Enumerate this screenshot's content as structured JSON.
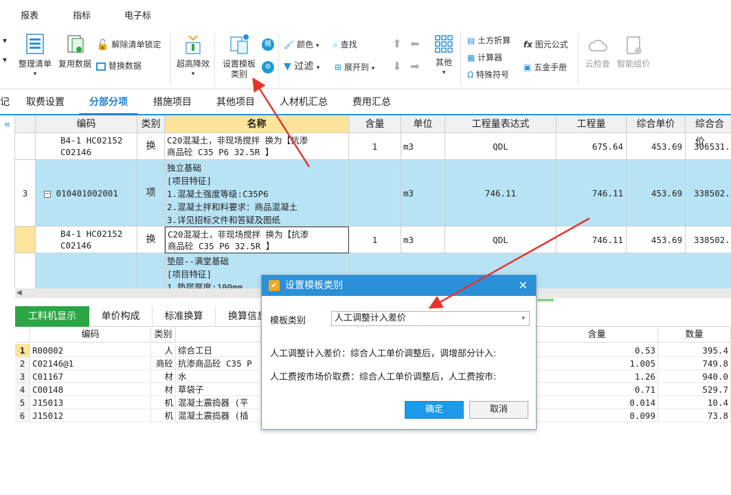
{
  "menu": {
    "items": [
      "报表",
      "指标",
      "电子标"
    ]
  },
  "ribbon": {
    "unlock": "解除清单锁定",
    "organize": "整理清单",
    "reuse": "复用数据",
    "replace": "替换数据",
    "downgrade": "超高降效",
    "set_template_line1": "设置模板",
    "set_template_line2": "类别",
    "color": "颜色",
    "find": "查找",
    "filter": "过滤",
    "expand": "展开到",
    "other": "其他",
    "earthwork": "土方折算",
    "calculator": "计算器",
    "special_symbol": "特殊符号",
    "formula": "图元公式",
    "hardware": "五金手册",
    "cloud_check": "云检查",
    "smart_price": "智能组价"
  },
  "tabs": [
    "记",
    "取费设置",
    "分部分项",
    "措施项目",
    "其他项目",
    "人材机汇总",
    "费用汇总"
  ],
  "grid": {
    "headers": [
      "编码",
      "类别",
      "名称",
      "含量",
      "单位",
      "工程量表达式",
      "工程量",
      "综合单价",
      "综合合价"
    ],
    "rows": [
      {
        "num": "",
        "code_l1": "B4-1 HC02152",
        "code_l2": "C02146",
        "type": "换",
        "name_l1": "C20混凝土，非现场搅拌  换为【抗渗",
        "name_l2": "商品砼 C35 P6 32.5R 】",
        "content": "1",
        "unit": "m3",
        "expr": "QDL",
        "qty": "675.64",
        "price": "453.69",
        "total": "306531."
      },
      {
        "num": "3",
        "code_l1": "010401002001",
        "type": "项",
        "name_lines": [
          "独立基础",
          "[项目特征]",
          "1.混凝土强度等级:C35P6",
          "2.混凝土拌和料要求：商品混凝土",
          "3.详见招标文件和答疑及图纸"
        ],
        "unit": "m3",
        "expr": "746.11",
        "qty": "746.11",
        "price": "453.69",
        "total": "338502."
      },
      {
        "num": "",
        "code_l1": "B4-1 HC02152",
        "code_l2": "C02146",
        "type": "换",
        "name_l1": "C20混凝土，非现场搅拌  换为【抗渗",
        "name_l2": "商品砼 C35 P6 32.5R 】",
        "content": "1",
        "unit": "m3",
        "expr": "QDL",
        "qty": "746.11",
        "price": "453.69",
        "total": "338502."
      },
      {
        "num": "",
        "name_lines": [
          "垫层--满堂基础",
          "[项目特征]",
          "1.垫层厚度:100mm"
        ]
      }
    ]
  },
  "subtabs": [
    "工料机显示",
    "单价构成",
    "标准换算",
    "换算信息"
  ],
  "subgrid": {
    "headers": [
      "编码",
      "类别",
      "含量",
      "数量"
    ],
    "rows": [
      {
        "n": "1",
        "code": "R00002",
        "type": "人",
        "name": "综合工日",
        "content": "0.53",
        "qty": "395.4"
      },
      {
        "n": "2",
        "code": "C02146@1",
        "type": "商砼",
        "name": "抗渗商品砼 C35 P",
        "content": "1.005",
        "qty": "749.8"
      },
      {
        "n": "3",
        "code": "C01167",
        "type": "材",
        "name": "水",
        "content": "1.26",
        "qty": "940.0"
      },
      {
        "n": "4",
        "code": "C00148",
        "type": "材",
        "name": "草袋子",
        "content": "0.71",
        "qty": "529.7"
      },
      {
        "n": "5",
        "code": "J15013",
        "type": "机",
        "name": "混凝土震捣器 (平",
        "content": "0.014",
        "qty": "10.4"
      },
      {
        "n": "6",
        "code": "J15012",
        "type": "机",
        "name": "混凝土震捣器 (插",
        "content": "0.099",
        "qty": "73.8"
      }
    ]
  },
  "dialog": {
    "title": "设置模板类别",
    "label": "模板类别",
    "selected": "人工调整计入差价",
    "desc1": "人工调整计入差价：综合人工单价调整后，调增部分计入:",
    "desc2": "人工费按市场价取费：综合人工单价调整后，人工费按市:",
    "ok": "确定",
    "cancel": "取消"
  },
  "colors": {
    "accent": "#2a90d8",
    "row_blue": "#b8e3f5",
    "green_tab": "#2ca645",
    "arrow": "#e8332a"
  }
}
